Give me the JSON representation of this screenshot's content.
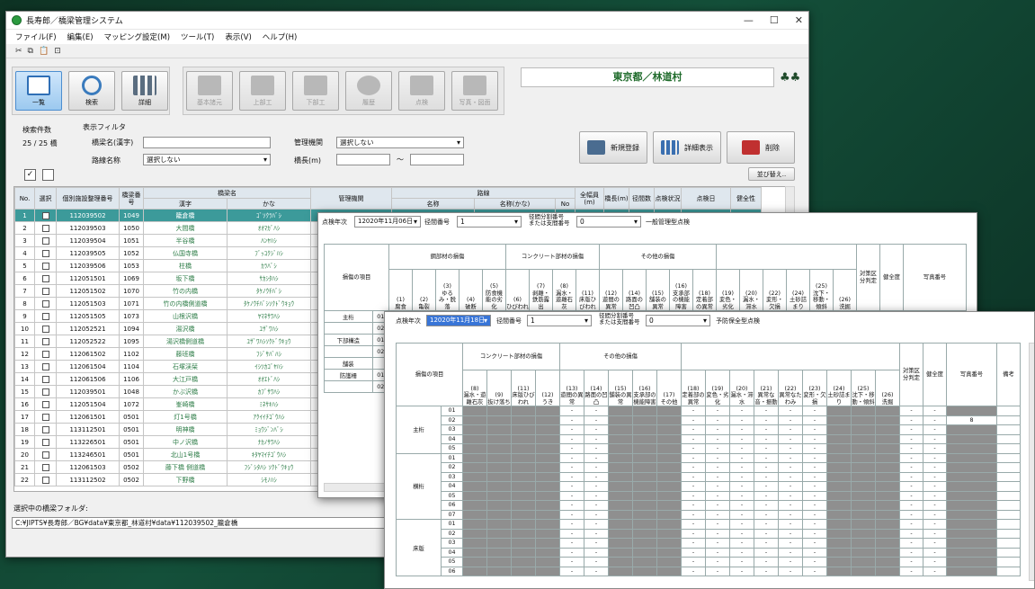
{
  "window": {
    "title": "長寿郎／橋梁管理システム"
  },
  "menu": [
    "ファイル(F)",
    "編集(E)",
    "マッピング設定(M)",
    "ツール(T)",
    "表示(V)",
    "ヘルプ(H)"
  ],
  "toolbar": {
    "cut": "✂",
    "copy": "⧉",
    "paste": "📋",
    "view": "⊡"
  },
  "nav": {
    "list": "一覧",
    "search": "検索",
    "detail": "詳細",
    "basic": "基本諸元",
    "super": "上部工",
    "sub": "下部工",
    "history": "履歴",
    "inspect": "点検",
    "photo": "写真・図面"
  },
  "location": {
    "label": "東京都／林道村"
  },
  "filter": {
    "count_label": "検索件数",
    "count": "25 / 25 橋",
    "group": "表示フィルタ",
    "bridge_name_label": "橋梁名(漢字)",
    "bridge_name_value": "",
    "manager_label": "管理機関",
    "manager_value": "選択しない",
    "route_label": "路線名称",
    "route_value": "選択しない",
    "length_label": "橋長(m)",
    "length_from": "",
    "tilde": "～",
    "length_to": ""
  },
  "actions": {
    "new": "新規登録",
    "detail_view": "詳細表示",
    "delete": "削除",
    "sort": "並び替え.."
  },
  "checks": {
    "all": "✓",
    "none": ""
  },
  "table": {
    "headers": {
      "no": "No.",
      "select": "選択",
      "id": "個別施設整理番号",
      "bridge_no": "橋梁番号",
      "name": "橋梁名",
      "kanji": "漢字",
      "kana": "かな",
      "manager": "管理機関",
      "route": "路線",
      "route_name": "名称",
      "route_kana": "名称(かな)",
      "route_no": "No",
      "width": "全幅員(m)",
      "length": "橋長(m)",
      "spans": "径間数",
      "inspect_status": "点検状況",
      "inspect_date": "点検日",
      "health": "健全性"
    },
    "rows": [
      {
        "no": "1",
        "id": "112039502",
        "bno": "1049",
        "kanji": "籠倉橋",
        "kana": "ｺﾞｿｸﾗﾊﾞｼ"
      },
      {
        "no": "2",
        "id": "112039503",
        "bno": "1050",
        "kanji": "大間橋",
        "kana": "ｵｵﾏｶﾞﾊｼ"
      },
      {
        "no": "3",
        "id": "112039504",
        "bno": "1051",
        "kanji": "半谷橋",
        "kana": "ﾊﾝﾔﾊｼ"
      },
      {
        "no": "4",
        "id": "112039505",
        "bno": "1052",
        "kanji": "仏国寺橋",
        "kana": "ﾌﾞｯｺｸｼﾞﾊｼ"
      },
      {
        "no": "5",
        "id": "112039506",
        "bno": "1053",
        "kanji": "柱橋",
        "kana": "ｶﾗﾊﾞｼ"
      },
      {
        "no": "6",
        "id": "112051501",
        "bno": "1069",
        "kanji": "坂下橋",
        "kana": "ｻｶｼﾀﾊｼ"
      },
      {
        "no": "7",
        "id": "112051502",
        "bno": "1070",
        "kanji": "竹の内橋",
        "kana": "ﾀｹﾉｳﾁﾊﾞｼ"
      },
      {
        "no": "8",
        "id": "112051503",
        "bno": "1071",
        "kanji": "竹の内橋側道橋",
        "kana": "ﾀｹﾉｳﾁﾊﾞｼｿｸﾄﾞｳｷｮｳ"
      },
      {
        "no": "9",
        "id": "112051505",
        "bno": "1073",
        "kanji": "山根沢橋",
        "kana": "ﾔﾏﾈｻﾜﾊｼ"
      },
      {
        "no": "10",
        "id": "112052521",
        "bno": "1094",
        "kanji": "湯沢橋",
        "kana": "ﾕｻﾞﾜﾊｼ"
      },
      {
        "no": "11",
        "id": "112052522",
        "bno": "1095",
        "kanji": "湯沢橋側道橋",
        "kana": "ﾕｻﾞﾜﾊｼｿｸﾄﾞｳｷｮｳ"
      },
      {
        "no": "12",
        "id": "112061502",
        "bno": "1102",
        "kanji": "藤班橋",
        "kana": "ﾌｼﾞｻﾊﾞﾊｼ"
      },
      {
        "no": "13",
        "id": "112061504",
        "bno": "1104",
        "kanji": "石塚渓栞",
        "kana": "ｲｼﾂｶｺﾞﾔﾊｼ"
      },
      {
        "no": "14",
        "id": "112061506",
        "bno": "1106",
        "kanji": "大江戸橋",
        "kana": "ｵｵｴﾄﾞﾊｼ"
      },
      {
        "no": "15",
        "id": "112039501",
        "bno": "1048",
        "kanji": "かぶ沢橋",
        "kana": "ｶﾌﾞｻﾜﾊｼ"
      },
      {
        "no": "16",
        "id": "112051504",
        "bno": "1072",
        "kanji": "峯崎橋",
        "kana": "ﾐﾈｻｷﾊｼ"
      },
      {
        "no": "17",
        "id": "112061501",
        "bno": "0501",
        "kanji": "灯1号橋",
        "kana": "ｱｸｲｲﾁｺﾞｳﾊｼ"
      },
      {
        "no": "18",
        "id": "113112501",
        "bno": "0501",
        "kanji": "明神橋",
        "kana": "ﾐｮｳｼﾞﾝﾊﾞｼ"
      },
      {
        "no": "19",
        "id": "113226501",
        "bno": "0501",
        "kanji": "中ノ沢橋",
        "kana": "ﾅｶﾉｻﾜﾊｼ"
      },
      {
        "no": "20",
        "id": "113246501",
        "bno": "0501",
        "kanji": "北山1号橋",
        "kana": "ｷﾀﾔﾏｲﾁｺﾞｳﾊｼ"
      },
      {
        "no": "21",
        "id": "112061503",
        "bno": "0502",
        "kanji": "藤下橋 側道橋",
        "kana": "ﾌｼﾞｼﾀﾊｼ ｿｸﾄﾞｳｷｮｳ"
      },
      {
        "no": "22",
        "id": "113112502",
        "bno": "0502",
        "kanji": "下野橋",
        "kana": "ｼﾓﾉﾊｼ"
      }
    ]
  },
  "folder": {
    "label": "選択中の橋梁フォルダ:",
    "path": "C:¥JIPTS¥長寿郎／BG¥data¥東京都_林道村¥data¥112039502_籠倉橋"
  },
  "sheet1": {
    "year_label": "点検年次",
    "year_value": "12020年11月06日",
    "bridge_label": "径間番号",
    "bridge_value": "1",
    "span_label": "径間分割番号\nまたは支間番号",
    "span_value": "0",
    "type": "一般管理型点検",
    "item_label": "損傷の項目",
    "groups": [
      "鋼部材の損傷",
      "コンクリート部材の損傷",
      "その他の損傷"
    ],
    "cols": [
      "(1)\n腐食",
      "(2)\n亀裂",
      "(3)\nゆるみ・脱落",
      "(4)\n破断",
      "(5)\n防食機能の劣化",
      "(6)\nひびわれ",
      "(7)\n剥離・鉄筋露出",
      "(8)\n漏水・遊離石灰",
      "(11)\n床版ひびわれ",
      "(12)\n遊間の異常",
      "(14)\n路面の凹凸",
      "(15)\n舗装の異常",
      "(16)\n支承部の機能障害",
      "(18)\n定着部の異常",
      "(19)\n変色・劣化",
      "(20)\n漏水・滞水",
      "(22)\n変形・欠損",
      "(24)\n土砂詰まり",
      "(25)\n沈下・移動・傾斜",
      "(26)\n洗掘"
    ],
    "right": [
      "対策区分判定",
      "健全度",
      "写真番号"
    ],
    "rows": [
      {
        "name": "主桁",
        "n": "01"
      },
      {
        "name": "",
        "n": "02"
      },
      {
        "name": "下部構造",
        "n": "01"
      },
      {
        "name": "",
        "n": "02"
      },
      {
        "name": "舗装",
        "n": ""
      },
      {
        "name": "防護柵",
        "n": "01"
      },
      {
        "name": "",
        "n": "02"
      }
    ]
  },
  "sheet2": {
    "year_label": "点検年次",
    "year_value": "12020年11月18日",
    "bridge_label": "径間番号",
    "bridge_value": "1",
    "span_label": "径間分割番号\nまたは支間番号",
    "span_value": "0",
    "type": "予防保全型点検",
    "item_label": "損傷の項目",
    "groups": [
      "コンクリート部材の損傷",
      "その他の損傷"
    ],
    "cols": [
      "(8)\n漏水・遊離石灰",
      "(9)\n抜け落ち",
      "(11)\n床版ひびわれ",
      "(12)\nうき",
      "(13)\n遊間の異常",
      "(14)\n路面の凹凸",
      "(15)\n舗装の異常",
      "(16)\n支承部の機能障害",
      "(17)\nその他",
      "(18)\n定着部の異常",
      "(19)\n変色・劣化",
      "(20)\n漏水・滞水",
      "(21)\n異常な音・振動",
      "(22)\n異常なたわみ",
      "(23)\n変形・欠損",
      "(24)\n土砂詰まり",
      "(25)\n沈下・移動・傾斜",
      "(26)\n洗掘"
    ],
    "right": [
      "対策区分判定",
      "健全度",
      "写真番号",
      "備考"
    ],
    "photo_value": "8",
    "blocks": [
      {
        "name": "主桁",
        "rows": [
          "01",
          "02",
          "03",
          "04",
          "05"
        ]
      },
      {
        "name": "横桁",
        "rows": [
          "01",
          "02",
          "03",
          "04",
          "05",
          "06",
          "07"
        ]
      },
      {
        "name": "床版",
        "rows": [
          "01",
          "02",
          "03",
          "04",
          "05",
          "06"
        ]
      }
    ]
  }
}
